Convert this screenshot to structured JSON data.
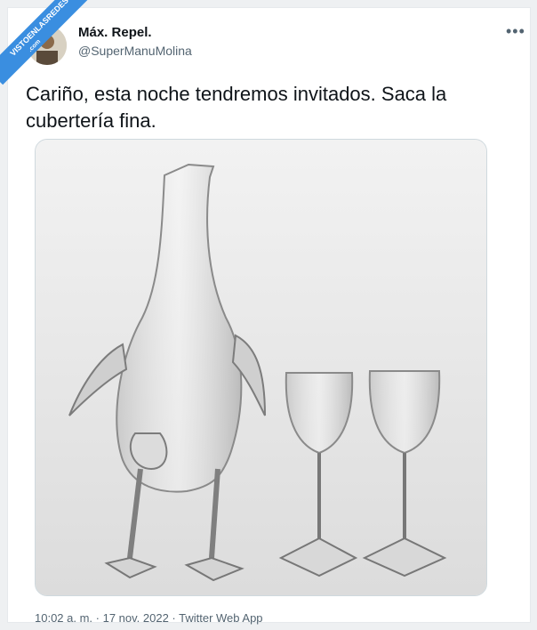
{
  "watermark": {
    "text": "VISTOENLASREDES",
    "suffix": ".com"
  },
  "tweet": {
    "author_name": "Máx. Repel.",
    "handle": "@SuperManuMolina",
    "more_label": "•••",
    "text": "Cariño, esta noche tendremos invitados. Saca la cubertería fina.",
    "timestamp": "10:02 a. m. · 17 nov. 2022 · Twitter Web App"
  },
  "colors": {
    "ribbon": "#3a8ee0",
    "text": "#0f1419",
    "secondary": "#536471"
  }
}
